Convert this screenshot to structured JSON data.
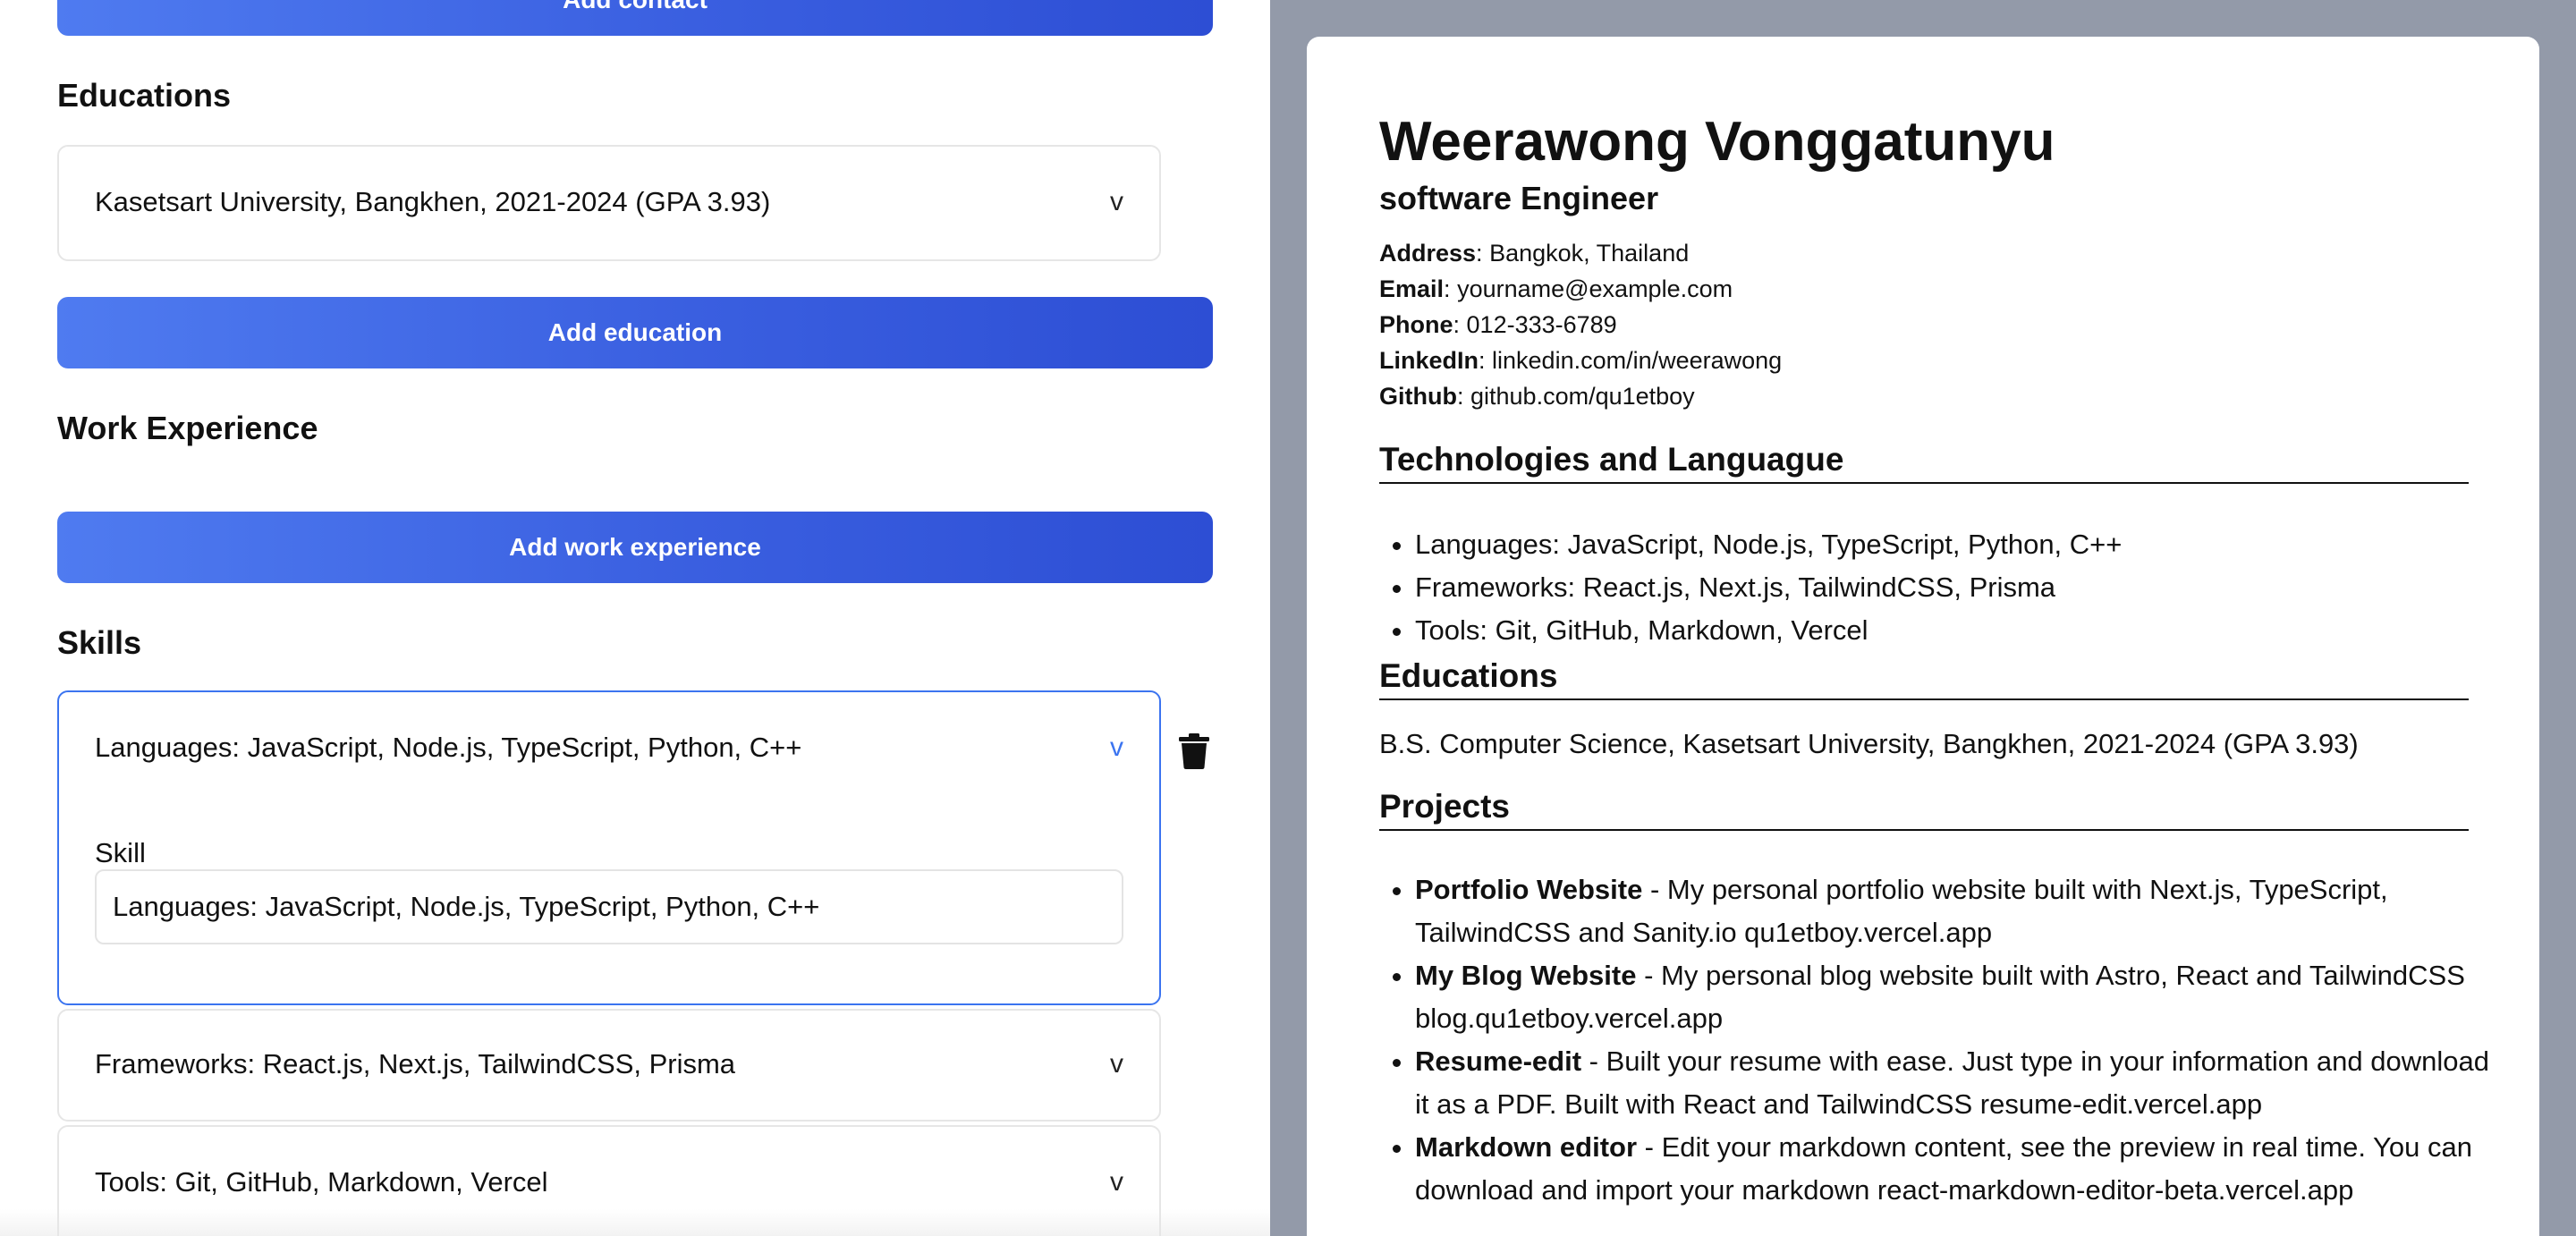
{
  "editor": {
    "add_contact_label": "Add contact",
    "educations": {
      "title": "Educations",
      "items": [
        {
          "summary": "Kasetsart University, Bangkhen, 2021-2024 (GPA 3.93)",
          "toggle": "v"
        }
      ],
      "add_label": "Add education"
    },
    "work": {
      "title": "Work Experience",
      "add_label": "Add work experience"
    },
    "skills": {
      "title": "Skills",
      "items": [
        {
          "summary": "Languages: JavaScript, Node.js, TypeScript, Python, C++",
          "toggle": "v",
          "expanded": true,
          "field_label": "Skill",
          "field_value": "Languages: JavaScript, Node.js, TypeScript, Python, C++"
        },
        {
          "summary": "Frameworks: React.js, Next.js, TailwindCSS, Prisma",
          "toggle": "v",
          "expanded": false
        },
        {
          "summary": "Tools: Git, GitHub, Markdown, Vercel",
          "toggle": "v",
          "expanded": false
        }
      ],
      "delete_icon": "trash-icon"
    },
    "colors": {
      "button_gradient_start": "#4f7bf0",
      "button_gradient_end": "#2d4ed4",
      "active_border": "#3b74f0"
    }
  },
  "resume": {
    "name": "Weerawong Vonggatunyu",
    "role": "software Engineer",
    "contact": [
      {
        "label": "Address",
        "sep": ": ",
        "value": "Bangkok, Thailand"
      },
      {
        "label": "Email",
        "sep": ": ",
        "value": "yourname@example.com"
      },
      {
        "label": "Phone",
        "sep": ": ",
        "value": "012-333-6789"
      },
      {
        "label": "LinkedIn",
        "sep": ": ",
        "value": "linkedin.com/in/weerawong"
      },
      {
        "label": "Github",
        "sep": ": ",
        "value": "github.com/qu1etboy"
      }
    ],
    "tech_title": "Technologies and Languague",
    "tech_items": [
      "Languages: JavaScript, Node.js, TypeScript, Python, C++",
      "Frameworks: React.js, Next.js, TailwindCSS, Prisma",
      "Tools: Git, GitHub, Markdown, Vercel"
    ],
    "edu_title": "Educations",
    "edu_line": "B.S. Computer Science, Kasetsart University, Bangkhen, 2021-2024 (GPA 3.93)",
    "projects_title": "Projects",
    "projects": [
      {
        "name": "Portfolio Website",
        "desc": " - My personal portfolio website built with Next.js, TypeScript, TailwindCSS and Sanity.io qu1etboy.vercel.app"
      },
      {
        "name": "My Blog Website",
        "desc": " - My personal blog website built with Astro, React and TailwindCSS blog.qu1etboy.vercel.app"
      },
      {
        "name": "Resume-edit",
        "desc": " - Built your resume with ease. Just type in your information and download it as a PDF. Built with React and TailwindCSS resume-edit.vercel.app"
      },
      {
        "name": "Markdown editor",
        "desc": " - Edit your markdown content, see the preview in real time. You can download and import your markdown react-markdown-editor-beta.vercel.app"
      }
    ],
    "background": "#939aa9"
  }
}
